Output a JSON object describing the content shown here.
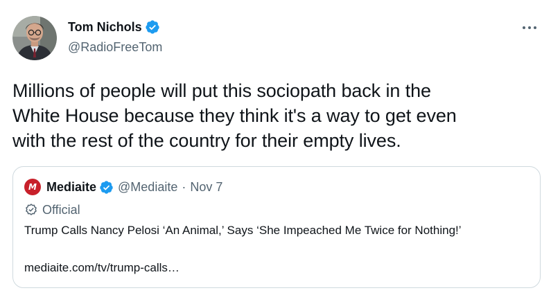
{
  "author": {
    "name": "Tom Nichols",
    "handle": "@RadioFreeTom",
    "verified": true
  },
  "tweet": {
    "text": "Millions of people will put this sociopath back in the\nWhite House because they think it's a way to get even\nwith the rest of the country for their empty lives."
  },
  "quoted": {
    "logo_letter": "M",
    "name": "Mediaite",
    "handle": "@Mediaite",
    "separator": "·",
    "date": "Nov 7",
    "official_label": "Official",
    "title": "Trump Calls Nancy Pelosi ‘An Animal,’ Says ‘She Impeached Me Twice for Nothing!’",
    "link": "mediaite.com/tv/trump-calls…"
  },
  "icons": {
    "verified": "verified-badge-icon",
    "more": "more-dots-icon",
    "official": "official-check-icon"
  },
  "colors": {
    "verified_blue": "#1d9bf0",
    "text": "#0f1419",
    "secondary": "#536471",
    "border": "#cfd9de",
    "mediaite_red": "#c8202a"
  }
}
